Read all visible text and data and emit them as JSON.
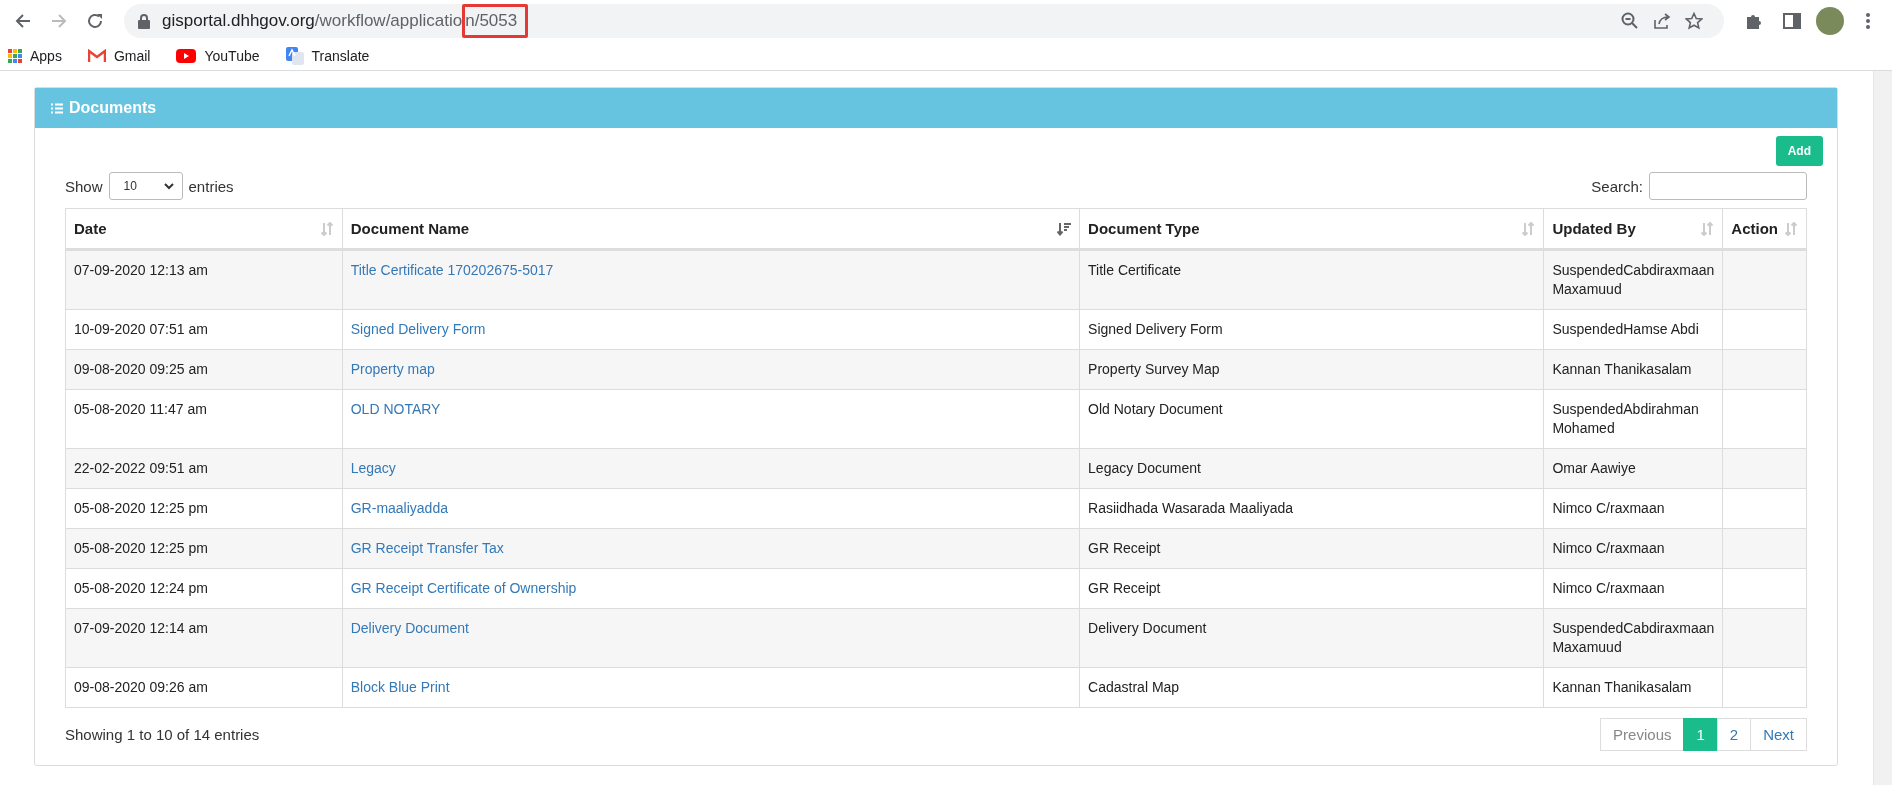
{
  "browser": {
    "url_host": "gisportal.dhhgov.org",
    "url_path": "/workflow/applicatio",
    "url_highlighted": "n/5053",
    "bookmarks": [
      {
        "label": "Apps",
        "kind": "apps"
      },
      {
        "label": "Gmail",
        "kind": "gmail"
      },
      {
        "label": "YouTube",
        "kind": "youtube"
      },
      {
        "label": "Translate",
        "kind": "translate"
      }
    ]
  },
  "panel": {
    "title": "Documents",
    "add_button": "Add",
    "length_label_before": "Show",
    "length_value": "10",
    "length_label_after": "entries",
    "search_label": "Search:",
    "columns": [
      {
        "label": "Date",
        "sorted": false
      },
      {
        "label": "Document Name",
        "sorted": true
      },
      {
        "label": "Document Type",
        "sorted": false
      },
      {
        "label": "Updated By",
        "sorted": false
      },
      {
        "label": "Action",
        "sorted": false
      }
    ],
    "rows": [
      {
        "date": "07-09-2020 12:13 am",
        "name": "Title Certificate 170202675-5017",
        "type": "Title Certificate",
        "updated_by": "SuspendedCabdiraxmaan Maxamuud"
      },
      {
        "date": "10-09-2020 07:51 am",
        "name": "Signed Delivery Form",
        "type": "Signed Delivery Form",
        "updated_by": "SuspendedHamse Abdi"
      },
      {
        "date": "09-08-2020 09:25 am",
        "name": "Property map",
        "type": "Property Survey Map",
        "updated_by": "Kannan Thanikasalam"
      },
      {
        "date": "05-08-2020 11:47 am",
        "name": "OLD NOTARY",
        "type": "Old Notary Document",
        "updated_by": "SuspendedAbdirahman Mohamed"
      },
      {
        "date": "22-02-2022 09:51 am",
        "name": "Legacy",
        "type": "Legacy Document",
        "updated_by": "Omar Aawiye"
      },
      {
        "date": "05-08-2020 12:25 pm",
        "name": "GR-maaliyadda",
        "type": "Rasiidhada Wasarada Maaliyada",
        "updated_by": "Nimco C/raxmaan"
      },
      {
        "date": "05-08-2020 12:25 pm",
        "name": "GR Receipt Transfer Tax",
        "type": "GR Receipt",
        "updated_by": "Nimco C/raxmaan"
      },
      {
        "date": "05-08-2020 12:24 pm",
        "name": "GR Receipt Certificate of Ownership",
        "type": "GR Receipt",
        "updated_by": "Nimco C/raxmaan"
      },
      {
        "date": "07-09-2020 12:14 am",
        "name": "Delivery Document",
        "type": "Delivery Document",
        "updated_by": "SuspendedCabdiraxmaan Maxamuud"
      },
      {
        "date": "09-08-2020 09:26 am",
        "name": "Block Blue Print",
        "type": "Cadastral Map",
        "updated_by": "Kannan Thanikasalam"
      }
    ],
    "info": "Showing 1 to 10 of 14 entries",
    "pagination": [
      {
        "label": "Previous",
        "disabled": true,
        "selected": false
      },
      {
        "label": "1",
        "disabled": false,
        "selected": true
      },
      {
        "label": "2",
        "disabled": false,
        "selected": false
      },
      {
        "label": "Next",
        "disabled": false,
        "selected": false
      }
    ]
  }
}
